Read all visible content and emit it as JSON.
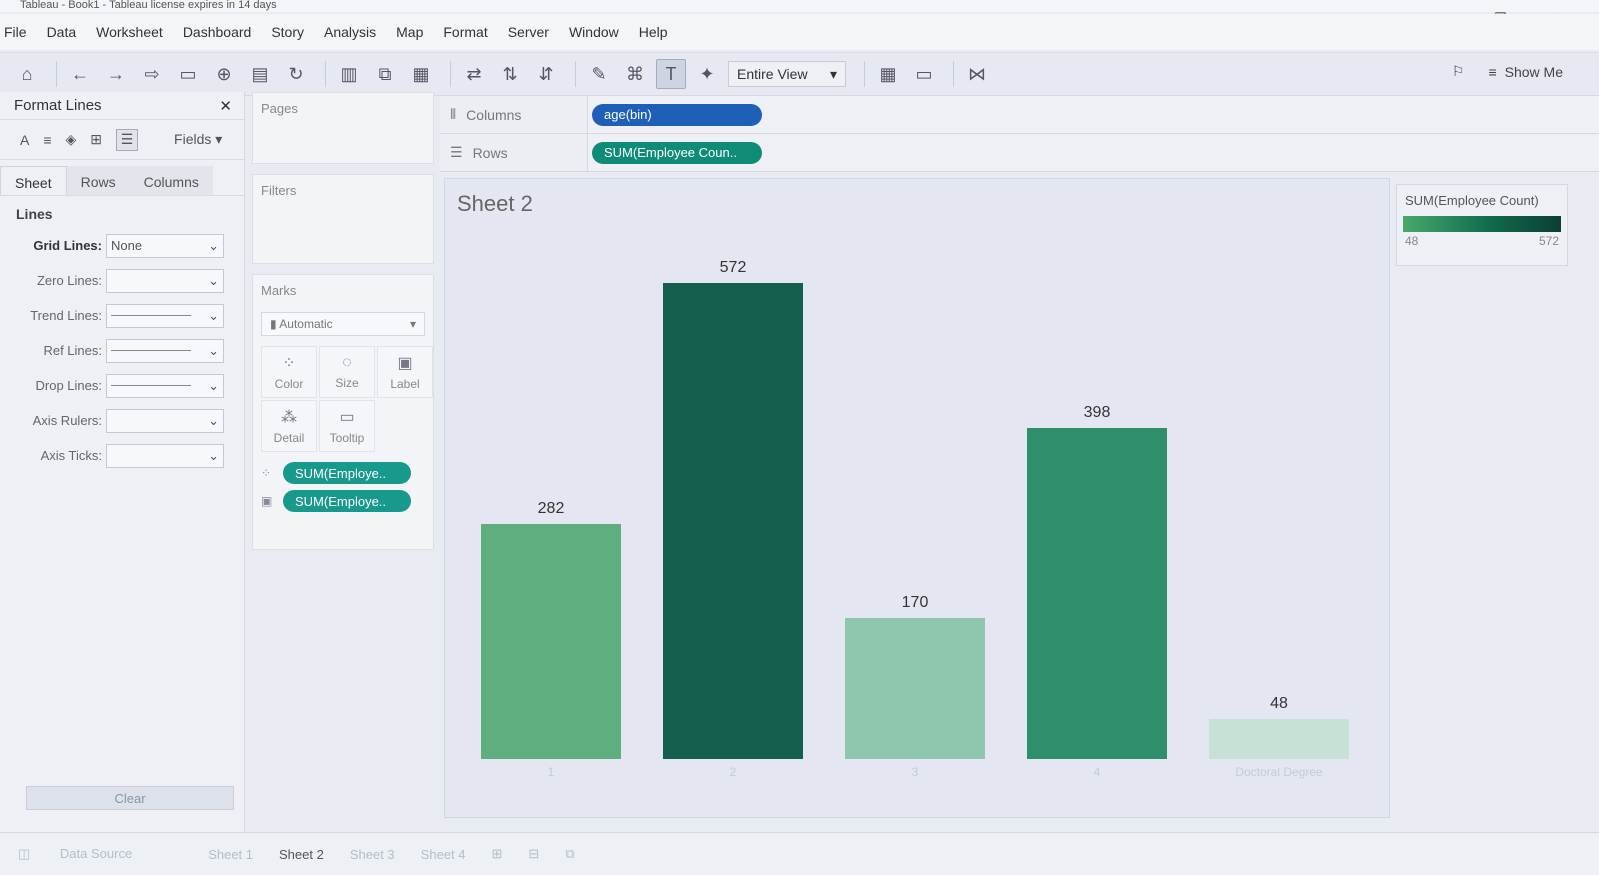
{
  "window": {
    "title": "Tableau - Book1 - Tableau license expires in 14 days"
  },
  "menu": [
    "File",
    "Data",
    "Worksheet",
    "Dashboard",
    "Story",
    "Analysis",
    "Map",
    "Format",
    "Server",
    "Window",
    "Help"
  ],
  "toolbar": {
    "view_select": "Entire View",
    "show_me": "Show Me"
  },
  "format_panel": {
    "title": "Format Lines",
    "fields_label": "Fields",
    "tabs": [
      "Sheet",
      "Rows",
      "Columns"
    ],
    "section": "Lines",
    "rows": [
      {
        "label": "Grid Lines:",
        "value": "None"
      },
      {
        "label": "Zero Lines:",
        "value": ""
      },
      {
        "label": "Trend Lines:",
        "value": ""
      },
      {
        "label": "Ref Lines:",
        "value": ""
      },
      {
        "label": "Drop Lines:",
        "value": ""
      },
      {
        "label": "Axis Rulers:",
        "value": ""
      },
      {
        "label": "Axis Ticks:",
        "value": ""
      }
    ],
    "clear": "Clear"
  },
  "cards": {
    "pages": "Pages",
    "filters": "Filters",
    "marks": "Marks",
    "mark_type": "Automatic",
    "buttons": [
      "Color",
      "Size",
      "Label",
      "Detail",
      "Tooltip"
    ],
    "pills": [
      "SUM(Employe..",
      "SUM(Employe.."
    ]
  },
  "shelves": {
    "columns_label": "Columns",
    "columns_pill": "age(bin)",
    "rows_label": "Rows",
    "rows_pill": "SUM(Employee Coun.."
  },
  "sheet_title": "Sheet 2",
  "legend": {
    "title": "SUM(Employee Count)",
    "min": "48",
    "max": "572"
  },
  "chart_data": {
    "type": "bar",
    "categories": [
      "1",
      "2",
      "3",
      "4",
      "Doctoral Degree"
    ],
    "values": [
      282,
      572,
      170,
      398,
      48
    ],
    "colors": [
      "#5fae80",
      "#135e4c",
      "#8ec7ad",
      "#2f8f6b",
      "#c8e1d6"
    ]
  },
  "sheet_tabs": [
    "Data Source",
    "Sheet 1",
    "Sheet 2",
    "Sheet 3",
    "Sheet 4"
  ]
}
